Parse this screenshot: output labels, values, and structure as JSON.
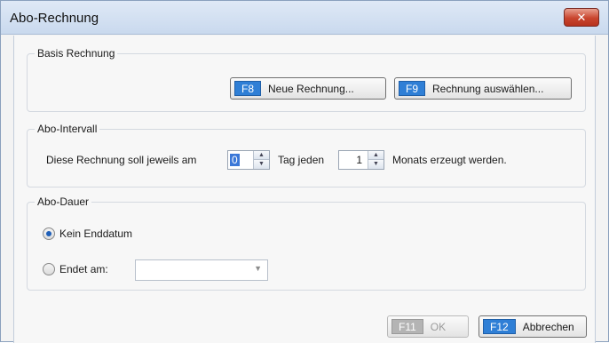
{
  "window": {
    "title": "Abo-Rechnung",
    "close_glyph": "✕"
  },
  "basis": {
    "title": "Basis Rechnung",
    "new_invoice": {
      "key": "F8",
      "label": "Neue Rechnung..."
    },
    "select_invoice": {
      "key": "F9",
      "label": "Rechnung auswählen..."
    }
  },
  "intervall": {
    "title": "Abo-Intervall",
    "prefix": "Diese Rechnung soll jeweils am",
    "day_value": "0",
    "middle": "Tag jeden",
    "month_value": "1",
    "suffix": "Monats erzeugt werden."
  },
  "dauer": {
    "title": "Abo-Dauer",
    "no_end_label": "Kein Enddatum",
    "no_end_selected": true,
    "ends_label": "Endet am:",
    "ends_selected": false,
    "date_value": ""
  },
  "footer": {
    "ok": {
      "key": "F11",
      "label": "OK",
      "enabled": false
    },
    "cancel": {
      "key": "F12",
      "label": "Abbrechen",
      "enabled": true
    }
  },
  "icons": {
    "spin_up": "▲",
    "spin_down": "▼",
    "dropdown": "▼"
  },
  "colors": {
    "fkey_accent": "#2f7fd6",
    "close_button": "#c9452e"
  }
}
